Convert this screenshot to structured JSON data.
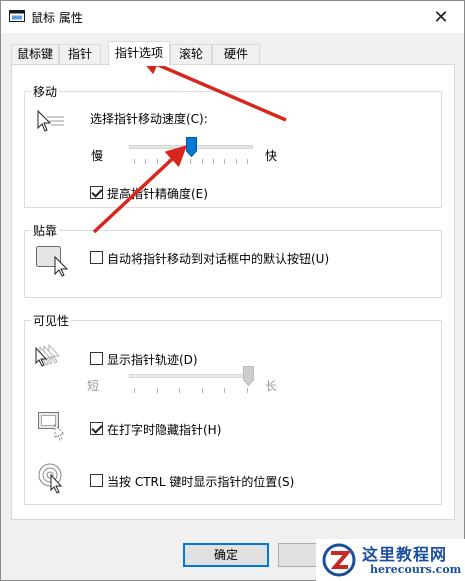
{
  "window": {
    "title": "鼠标 属性",
    "close_glyph": "✕"
  },
  "tabs": [
    {
      "label": "鼠标键"
    },
    {
      "label": "指针"
    },
    {
      "label": "指针选项",
      "active": true
    },
    {
      "label": "滚轮"
    },
    {
      "label": "硬件"
    }
  ],
  "motion": {
    "title": "移动",
    "speed_label": "选择指针移动速度(C):",
    "slow_label": "慢",
    "fast_label": "快",
    "speed_value": 6,
    "speed_max": 11,
    "precision_label": "提高指针精确度(E)",
    "precision_checked": true
  },
  "snap": {
    "title": "贴靠",
    "snap_label": "自动将指针移动到对话框中的默认按钮(U)",
    "snap_checked": false
  },
  "visibility": {
    "title": "可见性",
    "trails_label": "显示指针轨迹(D)",
    "trails_checked": false,
    "short_label": "短",
    "long_label": "长",
    "trail_value": 1.0,
    "hide_label": "在打字时隐藏指针(H)",
    "hide_checked": true,
    "ctrl_label": "当按 CTRL 键时显示指针的位置(S)",
    "ctrl_checked": false
  },
  "footer": {
    "ok_label": "确定"
  },
  "watermark": {
    "name": "这里教程网",
    "url": "herecours.com"
  },
  "colors": {
    "accent": "#0078d7",
    "annotation_arrow": "#d9261c",
    "watermark_text": "#1b4f9c"
  }
}
